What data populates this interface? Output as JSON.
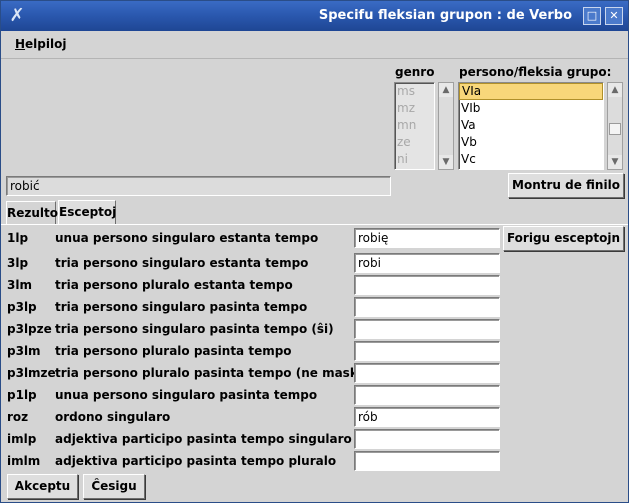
{
  "window": {
    "title": "Specifu fleksian grupon :  de Verbo",
    "app_icon": "x-app-icon",
    "maximize_glyph": "□",
    "close_glyph": "✕"
  },
  "menubar": {
    "help_first": "H",
    "help_rest": "elpiloj"
  },
  "genro": {
    "label": "genro",
    "items": [
      "ms",
      "mz",
      "mn",
      "ze",
      "ni"
    ]
  },
  "persono": {
    "label": "persono/fleksia grupo:",
    "items": [
      "VIa",
      "VIb",
      "Va",
      "Vb",
      "Vc"
    ],
    "selected_index": 0
  },
  "scroll": {
    "up": "▲",
    "down": "▼"
  },
  "word_field": {
    "value": "robić"
  },
  "show_forms_button": "Montru de finilo",
  "tabs": {
    "results": "Rezulto",
    "exceptions": "Esceptoj"
  },
  "remove_exception_button": "Forigu esceptojn",
  "rows": [
    {
      "code": "1lp",
      "desc": "unua persono singularo estanta tempo",
      "value": "robię"
    },
    {
      "code": "3lp",
      "desc": "tria persono singularo estanta tempo",
      "value": "robi"
    },
    {
      "code": "3lm",
      "desc": "tria persono pluralo estanta tempo",
      "value": ""
    },
    {
      "code": "p3lp",
      "desc": "tria persono singularo pasinta tempo",
      "value": ""
    },
    {
      "code": "p3lpze",
      "desc": "tria persono singularo pasinta tempo (ŝi)",
      "value": ""
    },
    {
      "code": "p3lm",
      "desc": "tria persono pluralo pasinta tempo",
      "value": ""
    },
    {
      "code": "p3lmze",
      "desc": "tria persono pluralo pasinta tempo (ne maskulina)",
      "value": ""
    },
    {
      "code": "p1lp",
      "desc": "unua persono singularo pasinta tempo",
      "value": ""
    },
    {
      "code": "roz",
      "desc": "ordono singularo",
      "value": "rób"
    },
    {
      "code": "imlp",
      "desc": "adjektiva participo pasinta tempo singularo",
      "value": ""
    },
    {
      "code": "imlm",
      "desc": "adjektiva participo pasinta tempo pluralo",
      "value": ""
    }
  ],
  "footer": {
    "accept": "Akceptu",
    "cancel": "Ĉesigu"
  }
}
